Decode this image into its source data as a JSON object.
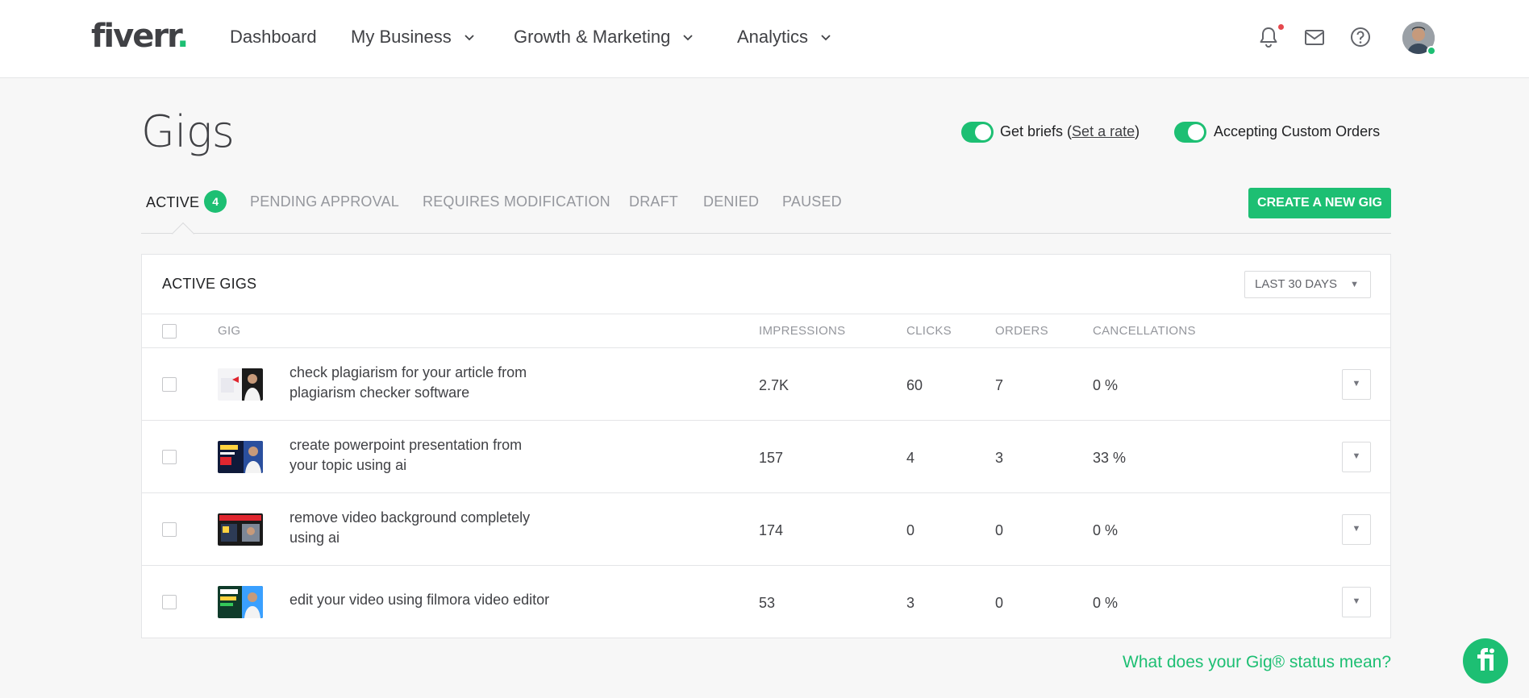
{
  "header": {
    "logo_text": "fiverr",
    "logo_dot": ".",
    "nav": [
      {
        "label": "Dashboard",
        "has_dropdown": false
      },
      {
        "label": "My Business",
        "has_dropdown": true
      },
      {
        "label": "Growth & Marketing",
        "has_dropdown": true
      },
      {
        "label": "Analytics",
        "has_dropdown": true
      }
    ],
    "icons": [
      "bell-icon",
      "mail-icon",
      "help-icon"
    ],
    "has_unread_notification": true,
    "user_online": true
  },
  "page": {
    "title": "Gigs",
    "get_briefs_label": "Get briefs",
    "set_rate_open": "(",
    "set_rate_label": "Set a rate",
    "set_rate_close": ")",
    "get_briefs_on": true,
    "custom_orders_label": "Accepting Custom Orders",
    "custom_orders_on": true
  },
  "tabs": [
    {
      "label": "ACTIVE",
      "count": "4",
      "active": true
    },
    {
      "label": "PENDING APPROVAL"
    },
    {
      "label": "REQUIRES MODIFICATION"
    },
    {
      "label": "DRAFT"
    },
    {
      "label": "DENIED"
    },
    {
      "label": "PAUSED"
    }
  ],
  "create_button": "CREATE A NEW GIG",
  "table": {
    "title": "ACTIVE GIGS",
    "range_selected": "LAST 30 DAYS",
    "columns": {
      "gig": "GIG",
      "impressions": "IMPRESSIONS",
      "clicks": "CLICKS",
      "orders": "ORDERS",
      "cancellations": "CANCELLATIONS"
    },
    "rows": [
      {
        "title_line1": "check plagiarism for your article from",
        "title_line2": "plagiarism checker software",
        "impressions": "2.7K",
        "clicks": "60",
        "orders": "7",
        "cancellations": "0 %"
      },
      {
        "title_line1": "create powerpoint presentation from",
        "title_line2": "your topic using ai",
        "impressions": "157",
        "clicks": "4",
        "orders": "3",
        "cancellations": "33 %"
      },
      {
        "title_line1": "remove video background completely",
        "title_line2": "using ai",
        "impressions": "174",
        "clicks": "0",
        "orders": "0",
        "cancellations": "0 %"
      },
      {
        "title_line1": "edit your video using filmora video editor",
        "title_line2": "",
        "impressions": "53",
        "clicks": "3",
        "orders": "0",
        "cancellations": "0 %"
      }
    ]
  },
  "status_link": "What does your Gig® status mean?",
  "colors": {
    "brand_green": "#1dbf73",
    "text_dark": "#404145",
    "text_muted": "#95979d",
    "notification_red": "#e5484d"
  }
}
